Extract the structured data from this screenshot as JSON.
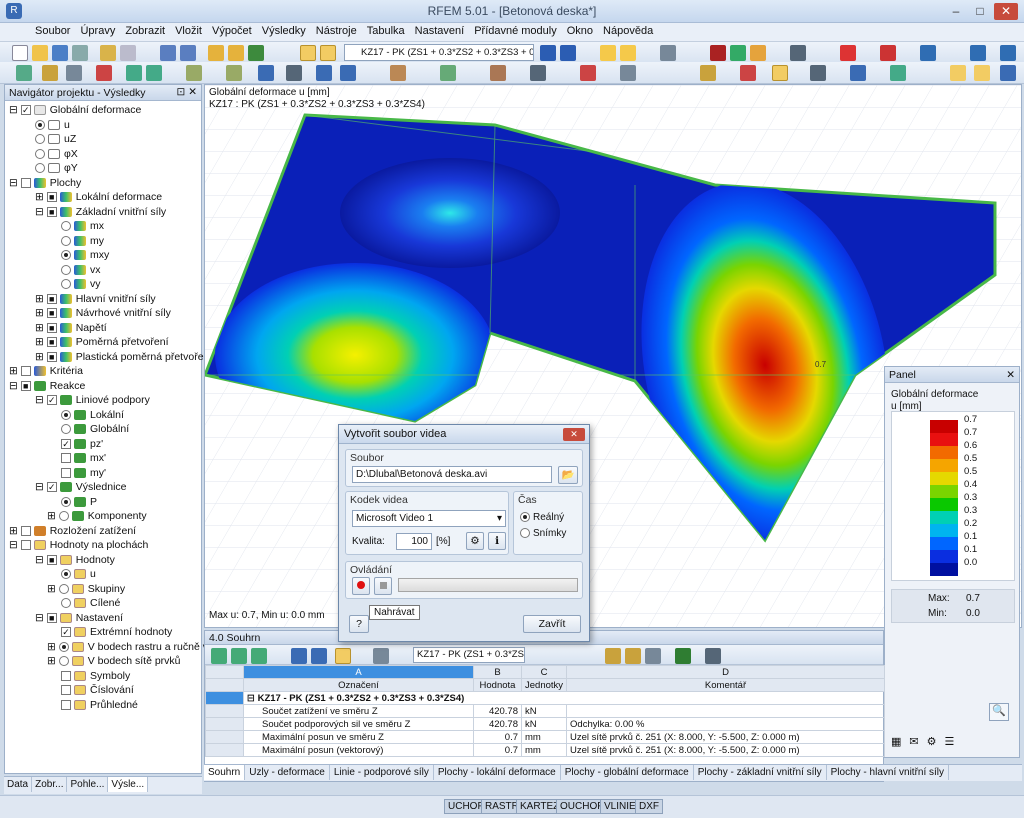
{
  "window": {
    "title": "RFEM 5.01 - [Betonová deska*]"
  },
  "menu": [
    "Soubor",
    "Úpravy",
    "Zobrazit",
    "Vložit",
    "Výpočet",
    "Výsledky",
    "Nástroje",
    "Tabulka",
    "Nastavení",
    "Přídavné moduly",
    "Okno",
    "Nápověda"
  ],
  "toolbar": {
    "loadcase": "KZ17 - PK (ZS1 + 0.3*ZS2 + 0.3*ZS3 + 0."
  },
  "navigator": {
    "title": "Navigátor projektu - Výsledky",
    "items": [
      "Globální deformace",
      "u",
      "uZ",
      "φX",
      "φY",
      "Plochy",
      "Lokální deformace",
      "Základní vnitřní síly",
      "mx",
      "my",
      "mxy",
      "vx",
      "vy",
      "Hlavní vnitřní síly",
      "Návrhové vnitřní síly",
      "Napětí",
      "Poměrná přetvoření",
      "Plastická poměrná přetvoření",
      "Kritéria",
      "Reakce",
      "Liniové podpory",
      "Lokální",
      "Globální",
      "pz'",
      "mx'",
      "my'",
      "Výslednice",
      "P",
      "Komponenty",
      "Rozložení zatížení",
      "Hodnoty na plochách",
      "Hodnoty",
      "u",
      "Skupiny",
      "Cílené",
      "Nastavení",
      "Extrémní hodnoty",
      "V bodech rastru a ručně vy",
      "V bodech sítě prvků",
      "Symboly",
      "Číslování",
      "Průhledné"
    ],
    "tabs": [
      "Data",
      "Zobr...",
      "Pohle...",
      "Výsle..."
    ]
  },
  "view": {
    "header1": "Globální deformace u [mm]",
    "header2": "KZ17 : PK (ZS1 + 0.3*ZS2 + 0.3*ZS3 + 0.3*ZS4)",
    "footer": "Max u: 0.7, Min u: 0.0 mm",
    "maxlabel": "0.7"
  },
  "panel": {
    "title": "Panel",
    "label1": "Globální deformace",
    "label2": "u [mm]",
    "legend": [
      "0.7",
      "0.7",
      "0.6",
      "0.5",
      "0.5",
      "0.4",
      "0.3",
      "0.3",
      "0.2",
      "0.1",
      "0.1",
      "0.0"
    ],
    "colors": [
      "#c80000",
      "#e81010",
      "#f26a00",
      "#f5a500",
      "#e5d800",
      "#7ad400",
      "#0ac800",
      "#00d0b4",
      "#00b4ef",
      "#0066ff",
      "#0a2ee0",
      "#0010a0"
    ],
    "max_label": "Max:",
    "max_value": "0.7",
    "min_label": "Min:",
    "min_value": "0.0"
  },
  "results": {
    "title": "4.0 Souhrn",
    "loadcase": "KZ17 - PK (ZS1 + 0.3*ZS",
    "col_letters": [
      "A",
      "B",
      "C",
      "D"
    ],
    "col_names": [
      "Označení",
      "Hodnota",
      "Jednotky",
      "Komentář"
    ],
    "group": "KZ17 - PK (ZS1 + 0.3*ZS2 + 0.3*ZS3 + 0.3*ZS4)",
    "rows": [
      [
        "Součet zatížení ve směru Z",
        "420.78",
        "kN",
        ""
      ],
      [
        "Součet podporových sil ve směru Z",
        "420.78",
        "kN",
        "Odchylka:  0.00 %"
      ],
      [
        "Maximální posun ve směru Z",
        "0.7",
        "mm",
        "Uzel sítě prvků č. 251  (X: 8.000,  Y: -5.500,  Z: 0.000 m)"
      ],
      [
        "Maximální posun (vektorový)",
        "0.7",
        "mm",
        "Uzel sítě prvků č. 251  (X: 8.000,  Y: -5.500,  Z: 0.000 m)"
      ]
    ],
    "tabs": [
      "Souhrn",
      "Uzly - deformace",
      "Linie - podporové síly",
      "Plochy - lokální deformace",
      "Plochy - globální deformace",
      "Plochy - základní vnitřní síly",
      "Plochy - hlavní vnitřní síly"
    ]
  },
  "status": [
    "UCHOP",
    "RASTR",
    "KARTEZ",
    "OUCHOP",
    "VLINIE",
    "DXF"
  ],
  "dialog": {
    "title": "Vytvořit soubor videa",
    "file_group": "Soubor",
    "file_path": "D:\\Dlubal\\Betonová deska.avi",
    "codec_group": "Kodek videa",
    "codec": "Microsoft Video 1",
    "quality_label": "Kvalita:",
    "quality": "100",
    "quality_unit": "[%]",
    "time_group": "Čas",
    "time_real": "Reálný",
    "time_frames": "Snímky",
    "control_group": "Ovládání",
    "tooltip": "Nahrávat",
    "close": "Zavřít"
  }
}
